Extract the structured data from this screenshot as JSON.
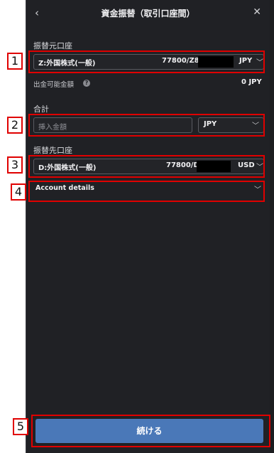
{
  "header": {
    "title": "資金振替（取引口座間）",
    "back_icon": "chevron-left-icon",
    "close_icon": "close-icon"
  },
  "source": {
    "label": "振替元口座",
    "account_name": "Z:外国株式(一般)",
    "account_prefix": "77800/Z8",
    "currency": "JPY"
  },
  "withdrawable": {
    "label": "出金可能金額",
    "value": "0 JPY"
  },
  "total": {
    "label": "合計",
    "amount_placeholder": "挿入金額",
    "currency": "JPY"
  },
  "destination": {
    "label": "振替先口座",
    "account_name": "D:外国株式(一般)",
    "account_prefix": "77800/D",
    "currency": "USD"
  },
  "account_details": {
    "label": "Account details"
  },
  "continue_button": {
    "label": "続ける"
  },
  "annotations": [
    "1",
    "2",
    "3",
    "4",
    "5"
  ],
  "colors": {
    "panel_bg": "#202125",
    "button_blue": "#4a78b8",
    "annotation_red": "#e00000"
  }
}
